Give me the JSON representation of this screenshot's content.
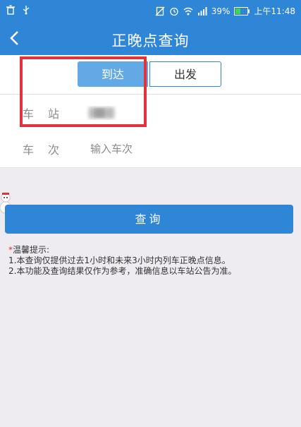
{
  "status": {
    "battery": "39%",
    "time": "上午11:48"
  },
  "nav": {
    "title": "正晚点查询"
  },
  "segments": {
    "arrive": "到达",
    "depart": "出发"
  },
  "station": {
    "label": "车站"
  },
  "train": {
    "label": "车次",
    "placeholder": "输入车次"
  },
  "query_button": "查询",
  "tips": {
    "title": "温馨提示:",
    "line1": "1.本查询仅提供过去1小时和未来3小时内列车正晚点信息。",
    "line2": "2.本功能及查询结果仅作为参考，准确信息以车站公告为准。"
  },
  "colors": {
    "accent": "#2f86d6",
    "selected": "#62a9e6",
    "highlight": "#e2323a"
  }
}
